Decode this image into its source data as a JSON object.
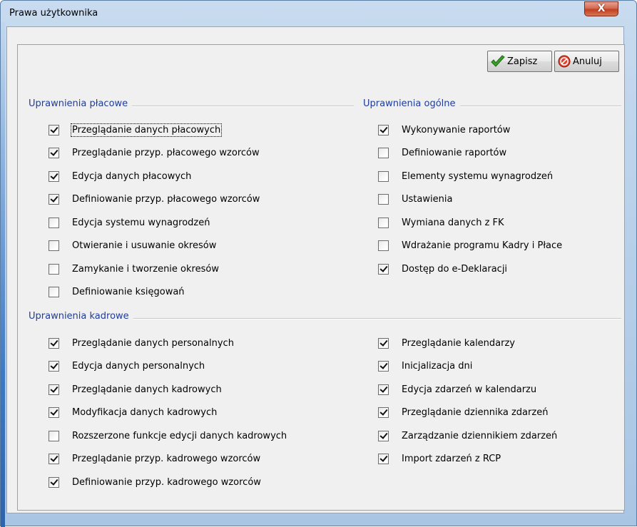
{
  "window": {
    "title": "Prawa użytkownika",
    "close_label": "X"
  },
  "toolbar": {
    "save_label": "Zapisz",
    "cancel_label": "Anuluj"
  },
  "colors": {
    "group_title": "#1f3c9a",
    "close_button": "#c23f25",
    "save_icon": "#3aa02a",
    "cancel_icon": "#d8301d"
  },
  "groups": {
    "placowe": {
      "title": "Uprawnienia płacowe",
      "items": [
        {
          "label": "Przeglądanie danych płacowych",
          "checked": true,
          "focused": true
        },
        {
          "label": "Przeglądanie przyp. płacowego wzorców",
          "checked": true
        },
        {
          "label": "Edycja danych płacowych",
          "checked": true
        },
        {
          "label": "Definiowanie przyp. płacowego wzorców",
          "checked": true
        },
        {
          "label": "Edycja systemu wynagrodzeń",
          "checked": false
        },
        {
          "label": "Otwieranie i usuwanie okresów",
          "checked": false
        },
        {
          "label": "Zamykanie i tworzenie okresów",
          "checked": false
        },
        {
          "label": "Definiowanie księgowań",
          "checked": false
        }
      ]
    },
    "ogolne": {
      "title": "Uprawnienia ogólne",
      "items": [
        {
          "label": "Wykonywanie raportów",
          "checked": true
        },
        {
          "label": "Definiowanie raportów",
          "checked": false
        },
        {
          "label": "Elementy systemu wynagrodzeń",
          "checked": false
        },
        {
          "label": "Ustawienia",
          "checked": false
        },
        {
          "label": "Wymiana danych z FK",
          "checked": false
        },
        {
          "label": "Wdrażanie programu Kadry i Płace",
          "checked": false
        },
        {
          "label": "Dostęp do e-Deklaracji",
          "checked": true
        }
      ]
    },
    "kadrowe": {
      "title": "Uprawnienia kadrowe",
      "left_items": [
        {
          "label": "Przeglądanie danych personalnych",
          "checked": true
        },
        {
          "label": "Edycja danych personalnych",
          "checked": true
        },
        {
          "label": "Przeglądanie danych kadrowych",
          "checked": true
        },
        {
          "label": "Modyfikacja danych kadrowych",
          "checked": true
        },
        {
          "label": "Rozszerzone funkcje edycji danych kadrowych",
          "checked": false
        },
        {
          "label": "Przeglądanie przyp. kadrowego wzorców",
          "checked": true
        },
        {
          "label": "Definiowanie przyp. kadrowego wzorców",
          "checked": true
        }
      ],
      "right_items": [
        {
          "label": "Przeglądanie kalendarzy",
          "checked": true
        },
        {
          "label": "Inicjalizacja dni",
          "checked": true
        },
        {
          "label": "Edycja zdarzeń w kalendarzu",
          "checked": true
        },
        {
          "label": "Przeglądanie dziennika zdarzeń",
          "checked": true
        },
        {
          "label": "Zarządzanie dziennikiem zdarzeń",
          "checked": true
        },
        {
          "label": "Import zdarzeń z RCP",
          "checked": true
        }
      ]
    }
  }
}
